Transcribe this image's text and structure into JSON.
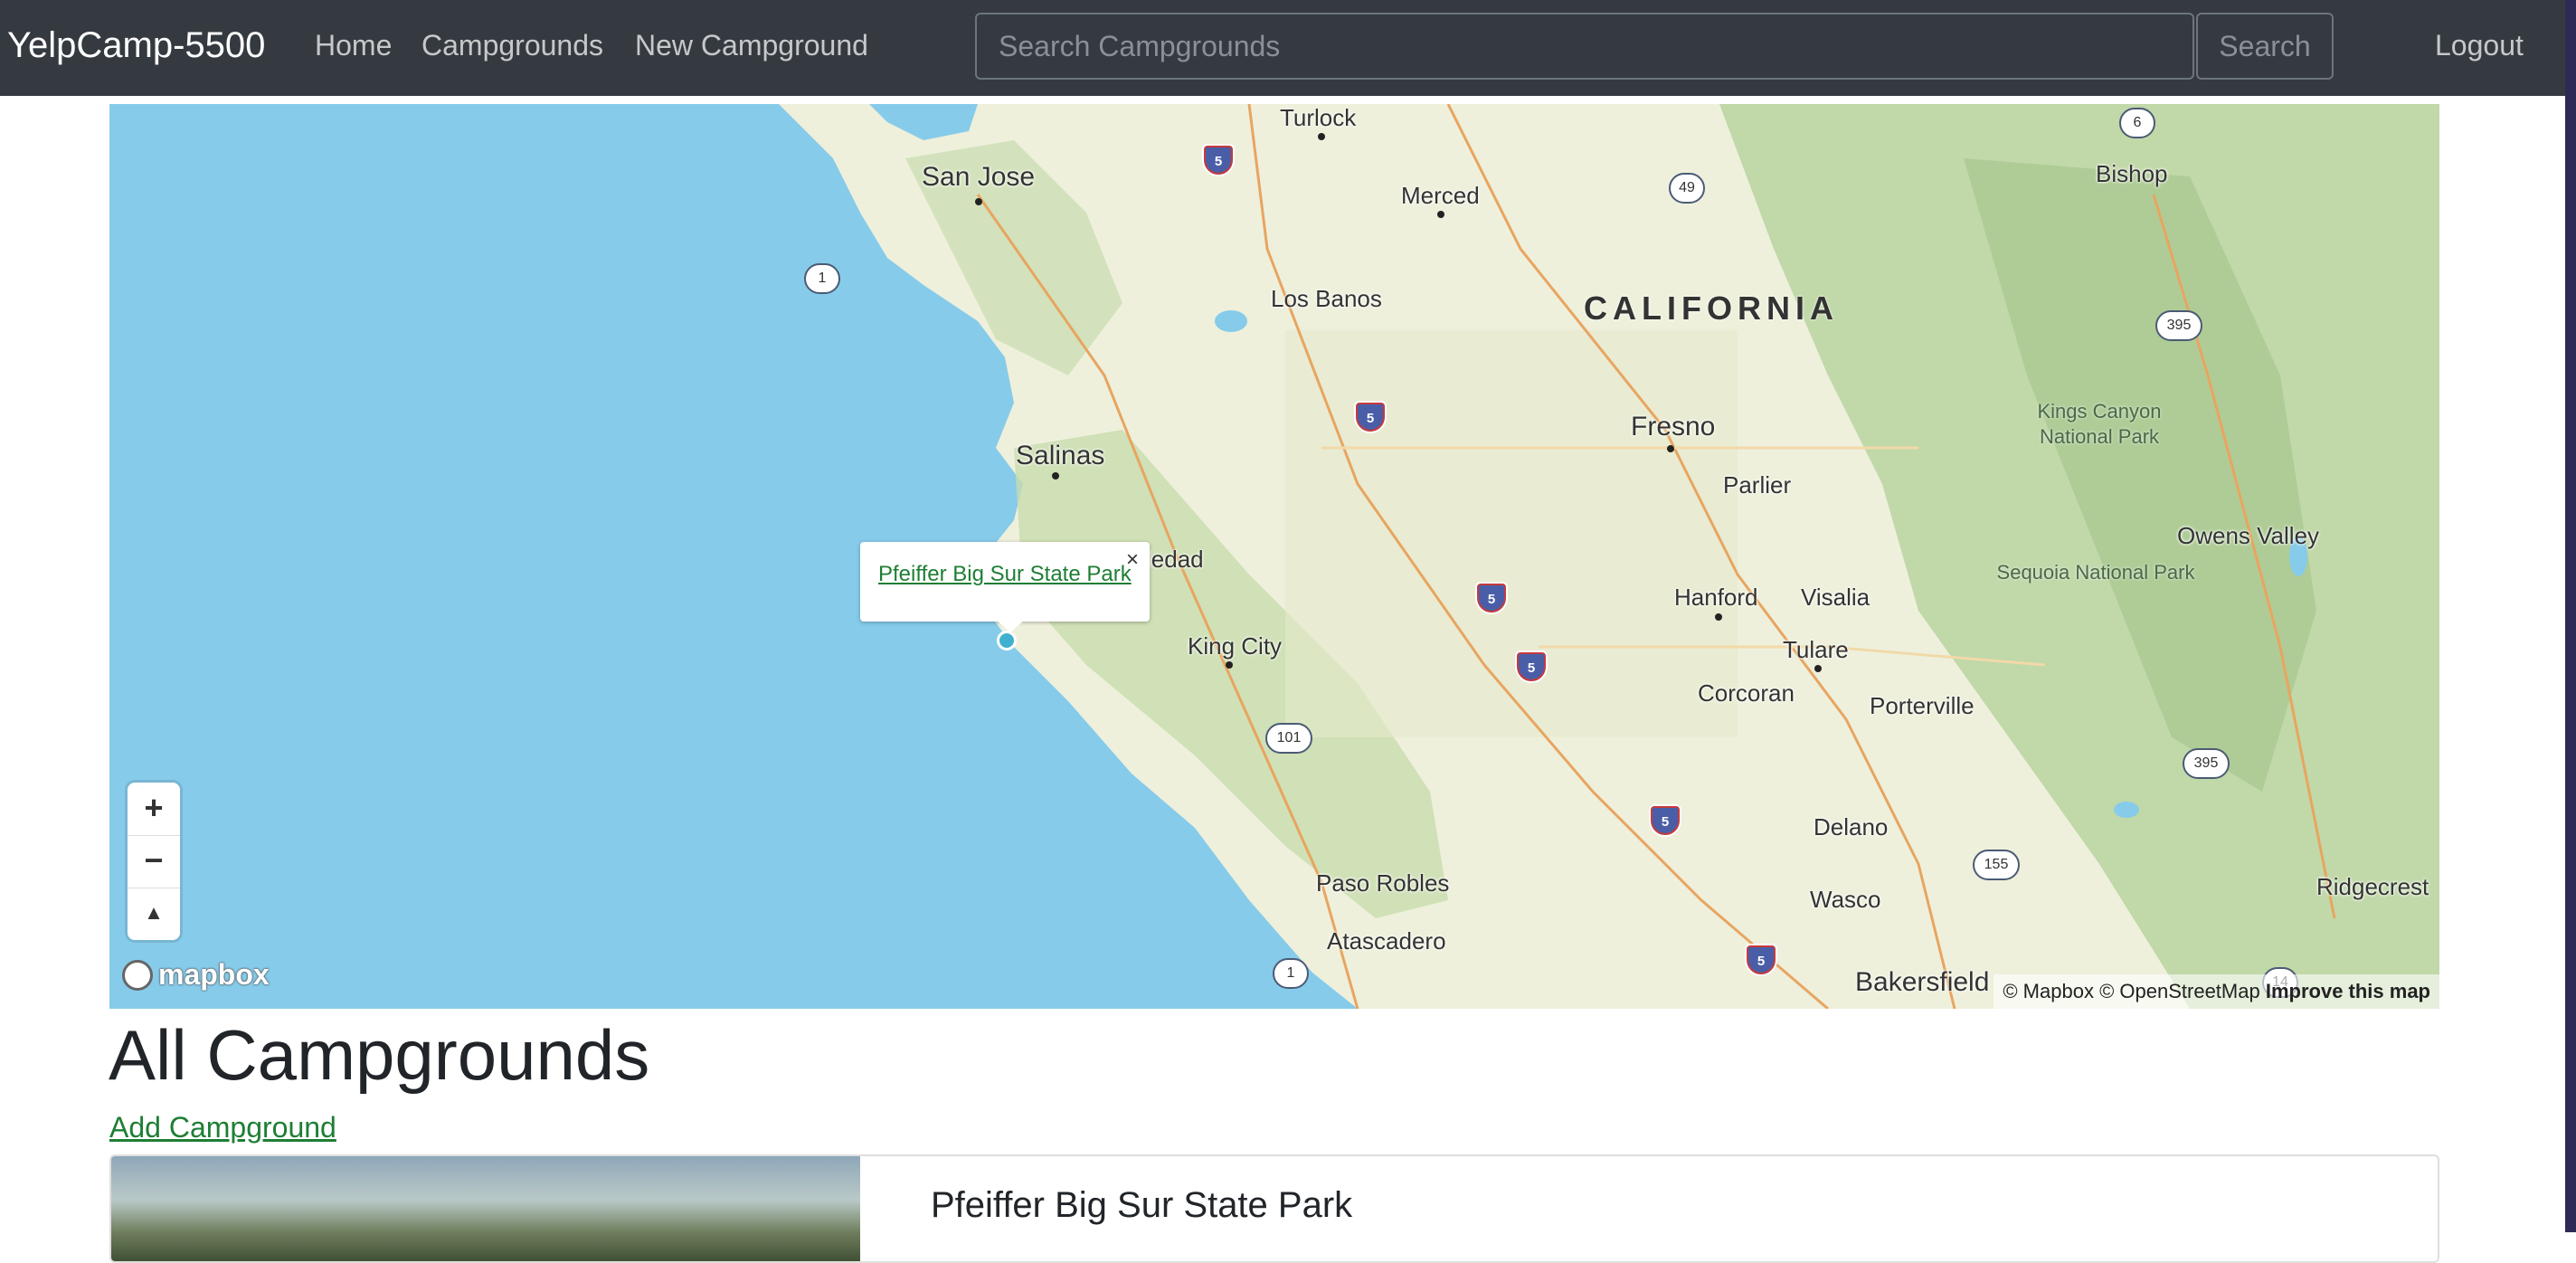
{
  "navbar": {
    "brand": "YelpCamp-5500",
    "links": [
      "Home",
      "Campgrounds",
      "New Campground"
    ],
    "search_placeholder": "Search Campgrounds",
    "search_button": "Search",
    "logout": "Logout"
  },
  "map": {
    "state_label": "CALIFORNIA",
    "cities": {
      "turlock": "Turlock",
      "san_jose": "San Jose",
      "merced": "Merced",
      "los_banos": "Los Banos",
      "bishop": "Bishop",
      "salinas": "Salinas",
      "fresno": "Fresno",
      "parlier": "Parlier",
      "soledad": "ledad",
      "hanford": "Hanford",
      "visalia": "Visalia",
      "king_city": "King City",
      "tulare": "Tulare",
      "corcoran": "Corcoran",
      "porterville": "Porterville",
      "owens_valley": "Owens Valley",
      "delano": "Delano",
      "paso_robles": "Paso Robles",
      "wasco": "Wasco",
      "ridgecrest": "Ridgecrest",
      "atascadero": "Atascadero",
      "bakersfield": "Bakersfield"
    },
    "parks": {
      "kings_canyon": "Kings Canyon National Park",
      "sequoia": "Sequoia National Park"
    },
    "shields": {
      "i5": "5",
      "r1": "1",
      "r49": "49",
      "r6": "6",
      "r395": "395",
      "r101": "101",
      "r155": "155",
      "r14": "14"
    },
    "popup": {
      "link": "Pfeiffer Big Sur State Park",
      "close": "×"
    },
    "controls": {
      "zoom_in": "+",
      "zoom_out": "−",
      "compass": "▲"
    },
    "logo": "mapbox",
    "attribution": {
      "mapbox": "© Mapbox",
      "osm": "© OpenStreetMap",
      "improve": "Improve this map"
    },
    "colors": {
      "water": "#86cbea",
      "land": "#eef0dc",
      "mountains": "#b9d3a0",
      "roads": "#e8a560"
    }
  },
  "content": {
    "title": "All Campgrounds",
    "add_link": "Add Campground",
    "cards": [
      {
        "title": "Pfeiffer Big Sur State Park"
      }
    ]
  }
}
